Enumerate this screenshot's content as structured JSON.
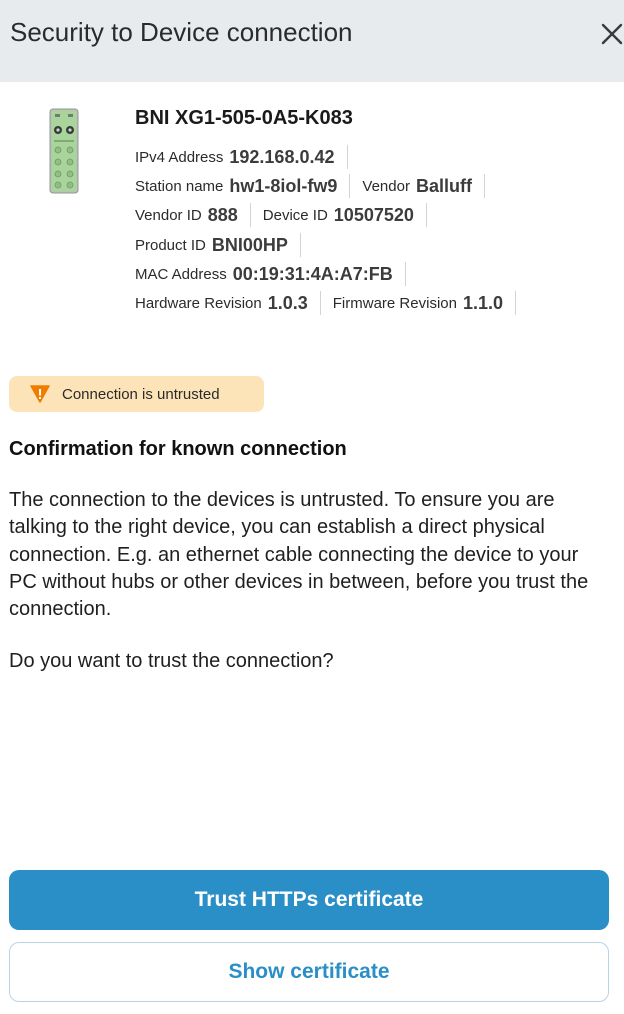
{
  "dialog": {
    "title": "Security to Device connection",
    "close_icon": "close-icon"
  },
  "device": {
    "name": "BNI XG1-505-0A5-K083",
    "image_icon": "io-module-device-image",
    "rows": [
      [
        {
          "label": "IPv4 Address",
          "value": "192.168.0.42"
        }
      ],
      [
        {
          "label": "Station name",
          "value": "hw1-8iol-fw9"
        },
        {
          "label": "Vendor",
          "value": "Balluff"
        }
      ],
      [
        {
          "label": "Vendor ID",
          "value": "888"
        },
        {
          "label": "Device ID",
          "value": "10507520"
        }
      ],
      [
        {
          "label": "Product ID",
          "value": "BNI00HP"
        }
      ],
      [
        {
          "label": "MAC Address",
          "value": "00:19:31:4A:A7:FB"
        }
      ],
      [
        {
          "label": "Hardware Revision",
          "value": "1.0.3"
        },
        {
          "label": "Firmware Revision",
          "value": "1.1.0"
        }
      ]
    ]
  },
  "status": {
    "label": "Connection is untrusted",
    "icon": "warning-icon",
    "badge_color": "#fde3b8",
    "icon_color": "#f07d00"
  },
  "confirmation": {
    "title": "Confirmation for known connection",
    "body": "The connection to the devices is untrusted. To ensure you are talking to the right device, you can establish a direct physical connection. E.g. an ethernet cable connecting the device to your PC without hubs or other devices in between, before you trust the connection.",
    "question": "Do you want to trust the connection?"
  },
  "actions": {
    "trust_label": "Trust HTTPs certificate",
    "show_label": "Show certificate",
    "accent_color": "#2b8fc7"
  }
}
